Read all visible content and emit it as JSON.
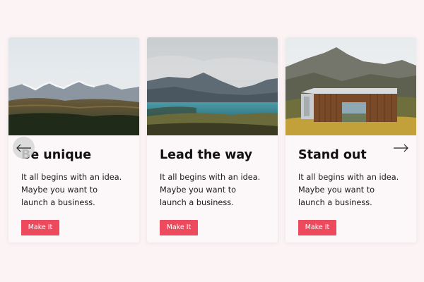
{
  "carousel": {
    "cards": [
      {
        "image": "mountain-landscape-photo",
        "title": "Be unique",
        "text": "It all begins with an idea. Maybe you want to launch a business.",
        "button_label": "Make It"
      },
      {
        "image": "lake-mountain-photo",
        "title": "Lead the way",
        "text": "It all begins with an idea. Maybe you want to launch a business.",
        "button_label": "Make It"
      },
      {
        "image": "cabin-mountain-photo",
        "title": "Stand out",
        "text": "It all begins with an idea. Maybe you want to launch a business.",
        "button_label": "Make It"
      }
    ],
    "prev_icon": "arrow-left-icon",
    "next_icon": "arrow-right-icon"
  },
  "colors": {
    "background": "#fbf3f4",
    "card": "#fcf7f8",
    "button": "#ee4a5d",
    "button_text": "#ffffff"
  }
}
